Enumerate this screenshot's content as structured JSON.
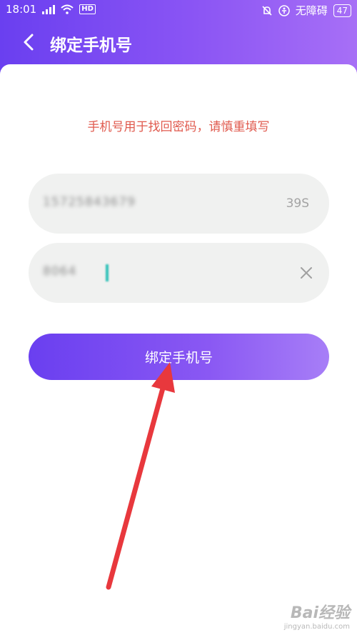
{
  "status_bar": {
    "time": "18:01",
    "network": "4G",
    "hd_badge": "HD",
    "accessibility_text": "无障碍",
    "battery": "47"
  },
  "nav": {
    "title": "绑定手机号"
  },
  "form": {
    "notice": "手机号用于找回密码，请慎重填写",
    "phone_value": "15725843679",
    "countdown": "39S",
    "code_value": "8064"
  },
  "actions": {
    "bind_label": "绑定手机号"
  },
  "watermark": {
    "brand": "Bai经验",
    "url": "jingyan.baidu.com"
  },
  "colors": {
    "accent_start": "#6a3ff0",
    "accent_end": "#a77ef7",
    "notice_red": "#e05a4e",
    "arrow_red": "#e8383d"
  }
}
